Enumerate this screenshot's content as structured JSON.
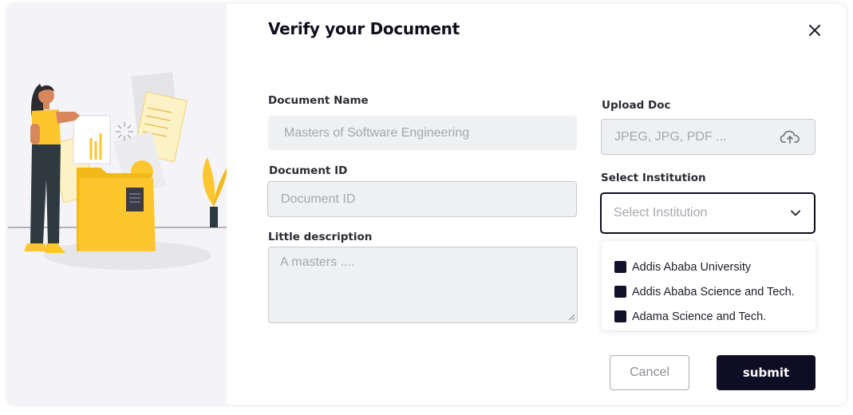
{
  "dialog": {
    "title": "Verify your Document",
    "close_icon": "close-icon"
  },
  "form": {
    "document_name": {
      "label": "Document Name",
      "value": "Masters of Software Engineering"
    },
    "document_id": {
      "label": "Document ID",
      "placeholder": "Document ID"
    },
    "description": {
      "label": "Little description",
      "placeholder": "A masters ...."
    },
    "upload": {
      "label": "Upload  Doc",
      "placeholder": "JPEG, JPG, PDF ...",
      "icon": "cloud-upload-icon"
    },
    "institution": {
      "label": "Select Institution",
      "placeholder": "Select Institution",
      "icon": "chevron-down-icon",
      "options": [
        "Addis Ababa University",
        "Addis Ababa Science and Tech.",
        "Adama Science and Tech."
      ]
    }
  },
  "actions": {
    "cancel_label": "Cancel",
    "submit_label": "submit"
  },
  "colors": {
    "primary": "#0e0d24",
    "accent_yellow": "#fec62e",
    "field_bg": "#eff0f2",
    "panel_bg": "#f4f4f8"
  }
}
